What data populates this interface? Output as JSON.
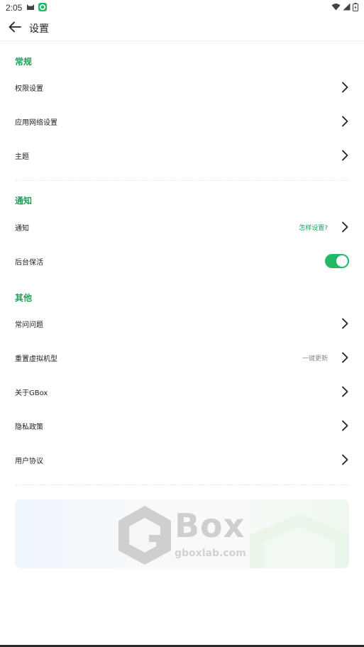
{
  "status_bar": {
    "time": "2:05"
  },
  "header": {
    "title": "设置"
  },
  "sections": {
    "general": {
      "title": "常规",
      "items": [
        {
          "label": "权限设置"
        },
        {
          "label": "应用网络设置"
        },
        {
          "label": "主题"
        }
      ]
    },
    "notification": {
      "title": "通知",
      "items": [
        {
          "label": "通知",
          "hint": "怎样设置?"
        },
        {
          "label": "后台保活",
          "toggle_on": true
        }
      ]
    },
    "other": {
      "title": "其他",
      "items": [
        {
          "label": "常问问题"
        },
        {
          "label": "重置虚拟机型",
          "hint": "一键更新"
        },
        {
          "label": "关于GBox"
        },
        {
          "label": "隐私政策"
        },
        {
          "label": "用户协议"
        }
      ]
    }
  },
  "banner": {
    "brand": "Box",
    "url": "gboxlab.com"
  },
  "colors": {
    "accent": "#1aa25a",
    "toggle": "#22b866"
  },
  "icons": [
    "wifi-icon",
    "signal-icon",
    "battery-icon",
    "back-arrow-icon",
    "chevron-right-icon"
  ]
}
